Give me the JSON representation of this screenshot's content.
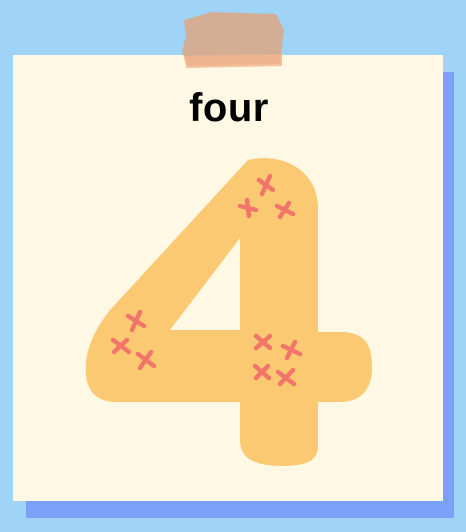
{
  "card": {
    "word": "four",
    "numeral": "4"
  },
  "colors": {
    "background": "#9fd3f7",
    "card": "#fff8e4",
    "card_shadow": "#7aa1f7",
    "numeral_fill": "#fbc972",
    "cross_marks": "#f2756a",
    "tape": "#d9a88a"
  },
  "icons": {
    "tape": "tape-strip-icon",
    "marks": "cross-mark-icon"
  }
}
